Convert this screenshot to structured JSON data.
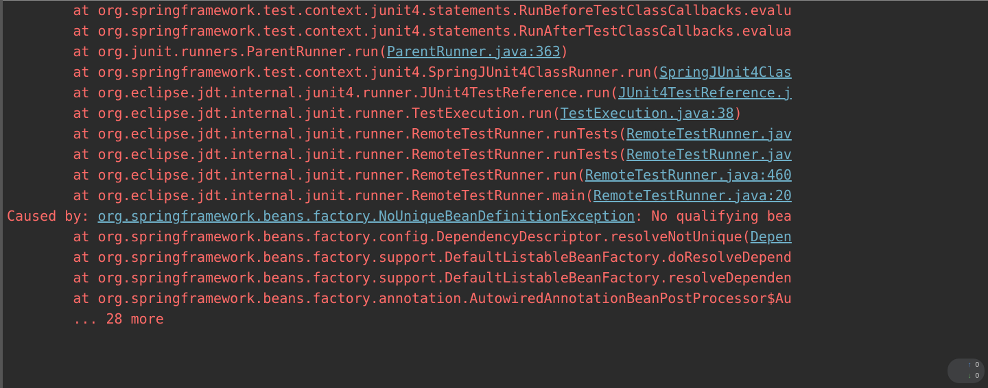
{
  "colors": {
    "background": "#2b2b2b",
    "error_text": "#ff6b68",
    "link_text": "#6fb0c8"
  },
  "lines": [
    {
      "indent": 2,
      "prefix": "at ",
      "text": "org.springframework.test.context.junit4.statements.RunBeforeTestClassCallbacks.evalu",
      "link": null
    },
    {
      "indent": 2,
      "prefix": "at ",
      "text": "org.springframework.test.context.junit4.statements.RunAfterTestClassCallbacks.evalua",
      "link": null
    },
    {
      "indent": 2,
      "prefix": "at ",
      "text": "org.junit.runners.ParentRunner.run(",
      "link": "ParentRunner.java:363",
      "after": ")"
    },
    {
      "indent": 2,
      "prefix": "at ",
      "text": "org.springframework.test.context.junit4.SpringJUnit4ClassRunner.run(",
      "link": "SpringJUnit4Clas",
      "after": null
    },
    {
      "indent": 2,
      "prefix": "at ",
      "text": "org.eclipse.jdt.internal.junit4.runner.JUnit4TestReference.run(",
      "link": "JUnit4TestReference.j",
      "after": null
    },
    {
      "indent": 2,
      "prefix": "at ",
      "text": "org.eclipse.jdt.internal.junit.runner.TestExecution.run(",
      "link": "TestExecution.java:38",
      "after": ")"
    },
    {
      "indent": 2,
      "prefix": "at ",
      "text": "org.eclipse.jdt.internal.junit.runner.RemoteTestRunner.runTests(",
      "link": "RemoteTestRunner.jav",
      "after": null
    },
    {
      "indent": 2,
      "prefix": "at ",
      "text": "org.eclipse.jdt.internal.junit.runner.RemoteTestRunner.runTests(",
      "link": "RemoteTestRunner.jav",
      "after": null
    },
    {
      "indent": 2,
      "prefix": "at ",
      "text": "org.eclipse.jdt.internal.junit.runner.RemoteTestRunner.run(",
      "link": "RemoteTestRunner.java:460",
      "after": null
    },
    {
      "indent": 2,
      "prefix": "at ",
      "text": "org.eclipse.jdt.internal.junit.runner.RemoteTestRunner.main(",
      "link": "RemoteTestRunner.java:20",
      "after": null
    }
  ],
  "caused_by_line": {
    "label": "Caused by: ",
    "exception_link": "org.springframework.beans.factory.NoUniqueBeanDefinitionException",
    "tail": ": No qualifying bea"
  },
  "cause_lines": [
    {
      "indent": 2,
      "prefix": "at ",
      "text": "org.springframework.beans.factory.config.DependencyDescriptor.resolveNotUnique(",
      "link": "Depen",
      "after": null
    },
    {
      "indent": 2,
      "prefix": "at ",
      "text": "org.springframework.beans.factory.support.DefaultListableBeanFactory.doResolveDepend",
      "link": null
    },
    {
      "indent": 2,
      "prefix": "at ",
      "text": "org.springframework.beans.factory.support.DefaultListableBeanFactory.resolveDependen",
      "link": null
    },
    {
      "indent": 2,
      "prefix": "at ",
      "text": "org.springframework.beans.factory.annotation.AutowiredAnnotationBeanPostProcessor$Au",
      "link": null
    }
  ],
  "more_line": {
    "indent": 2,
    "text": "... 28 more"
  },
  "indicator": {
    "up": "0",
    "down": "0"
  }
}
